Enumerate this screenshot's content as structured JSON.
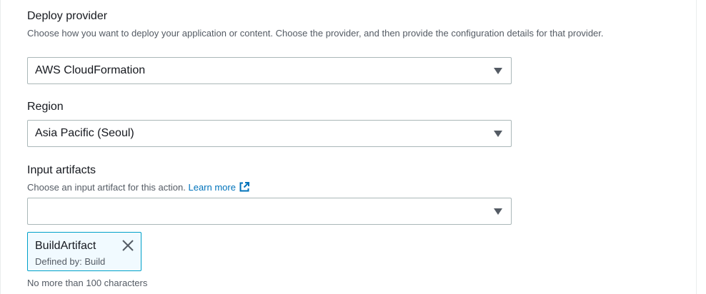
{
  "deploy_provider": {
    "label": "Deploy provider",
    "description": "Choose how you want to deploy your application or content. Choose the provider, and then provide the configuration details for that provider.",
    "selected": "AWS CloudFormation"
  },
  "region": {
    "label": "Region",
    "selected": "Asia Pacific (Seoul)"
  },
  "input_artifacts": {
    "label": "Input artifacts",
    "description": "Choose an input artifact for this action.",
    "learn_more": "Learn more",
    "selected": "",
    "tokens": [
      {
        "name": "BuildArtifact",
        "defined_by": "Defined by: Build"
      }
    ],
    "hint": "No more than 100 characters"
  },
  "icons": {
    "dropdown": "caret-down-icon",
    "external": "external-link-icon",
    "remove": "close-icon"
  },
  "colors": {
    "link": "#0073bb",
    "token_border": "#00a1c9",
    "token_background": "#f1faff"
  }
}
